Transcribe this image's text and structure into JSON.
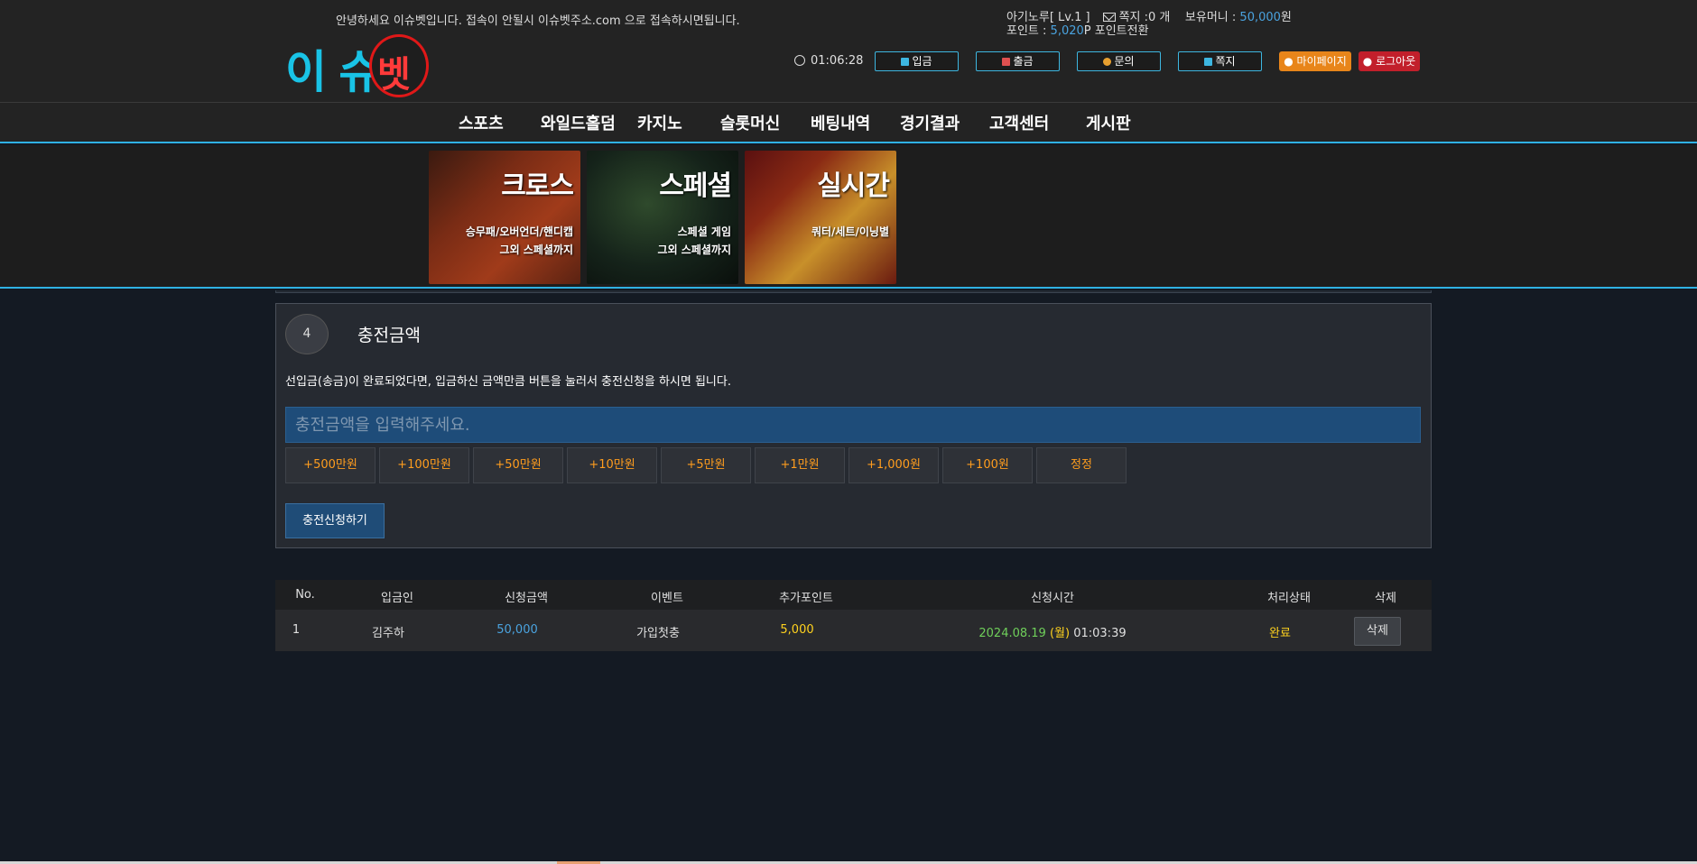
{
  "header": {
    "notice": "안녕하세요 이슈벳입니다. 접속이 안될시 이슈벳주소.com 으로 접속하시면됩니다.",
    "user": {
      "name_level": "아기노루[ Lv.1 ]",
      "memo_label": "쪽지 :0 개",
      "money_label": "보유머니 :",
      "money_value": "50,000",
      "money_unit": "원",
      "point_label": "포인트 :",
      "point_value": "5,020",
      "point_suffix": "P 포인트전환"
    },
    "logo": {
      "left": "이 슈",
      "circle": "벳"
    },
    "clock": "01:06:28",
    "buttons": {
      "deposit": "입금",
      "withdraw": "출금",
      "inquiry": "문의",
      "memo": "쪽지",
      "mypage": "마이페이지",
      "logout": "로그아웃"
    },
    "colors": {
      "accent": "#2fb1e3",
      "orange": "#e8851a",
      "red": "#c21f2b",
      "point_blue": "#4aa3df"
    }
  },
  "nav": [
    "스포츠",
    "와일드홀덤",
    "카지노",
    "슬롯머신",
    "베팅내역",
    "경기결과",
    "고객센터",
    "게시판"
  ],
  "banners": [
    {
      "title": "크로스",
      "sub1": "승무패/오버언더/핸디캡",
      "sub2": "그외 스페셜까지"
    },
    {
      "title": "스페셜",
      "sub1": "스페셜 게임",
      "sub2": "그외 스페셜까지"
    },
    {
      "title": "실시간",
      "sub1": "쿼터/세트/이닝별",
      "sub2": ""
    }
  ],
  "panel": {
    "step": "4",
    "title": "충전금액",
    "description": "선입금(송금)이 완료되었다면, 입금하신 금액만큼 버튼을 눌러서 충전신청을 하시면 됩니다.",
    "input_placeholder": "충전금액을 입력해주세요.",
    "amount_buttons": [
      "+500만원",
      "+100만원",
      "+50만원",
      "+10만원",
      "+5만원",
      "+1만원",
      "+1,000원",
      "+100원",
      "정정"
    ],
    "submit_label": "충전신청하기"
  },
  "table": {
    "headers": [
      "No.",
      "입금인",
      "신청금액",
      "이벤트",
      "추가포인트",
      "신청시간",
      "처리상태",
      "삭제"
    ],
    "rows": [
      {
        "no": "1",
        "depositor": "김주하",
        "amount": "50,000",
        "event": "가입첫충",
        "bonus": "5,000",
        "date": "2024.08.19",
        "weekday": "(월)",
        "time": "01:03:39",
        "status": "완료",
        "delete_label": "삭제"
      }
    ]
  }
}
